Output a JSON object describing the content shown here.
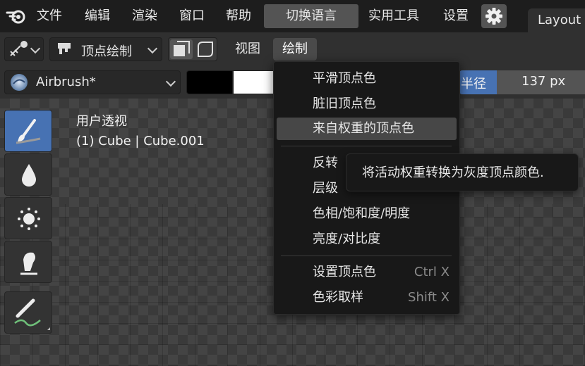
{
  "topbar": {
    "menus": [
      "文件",
      "编辑",
      "渲染",
      "窗口",
      "帮助"
    ],
    "language_button": "切换语言",
    "extra_menus": [
      "实用工具",
      "设置"
    ],
    "workspace_tab": "Layout"
  },
  "header": {
    "mode_label": "顶点绘制",
    "view_menu": "视图",
    "paint_menu": "绘制"
  },
  "tool_settings": {
    "brush_name": "Airbrush*",
    "primary_color": "#000000",
    "secondary_color": "#ffffff",
    "radius_label": "半径",
    "radius_value": "137 px",
    "radius_fill_fraction": 0.3
  },
  "viewport": {
    "view_name": "用户透视",
    "object_info": "(1) Cube | Cube.001"
  },
  "toolbar": {
    "tools": [
      "brush-tool",
      "blur-tool",
      "average-tool",
      "smear-tool",
      "annotate-tool"
    ],
    "active": "brush-tool"
  },
  "paint_menu": {
    "items": [
      {
        "label": "平滑顶点色",
        "shortcut": ""
      },
      {
        "label": "脏旧顶点色",
        "shortcut": ""
      },
      {
        "label": "来自权重的顶点色",
        "shortcut": "",
        "highlighted": true
      },
      {
        "label": "反转",
        "shortcut": ""
      },
      {
        "label": "层级",
        "shortcut": ""
      },
      {
        "label": "色相/饱和度/明度",
        "shortcut": ""
      },
      {
        "label": "亮度/对比度",
        "shortcut": ""
      },
      {
        "label": "设置顶点色",
        "shortcut": "Ctrl X"
      },
      {
        "label": "色彩取样",
        "shortcut": "Shift X"
      }
    ]
  },
  "tooltip": {
    "text": "将活动权重转换为灰度顶点颜色."
  },
  "colors": {
    "accent": "#4772b3",
    "menu_bg": "#181818",
    "highlight": "#474747"
  }
}
